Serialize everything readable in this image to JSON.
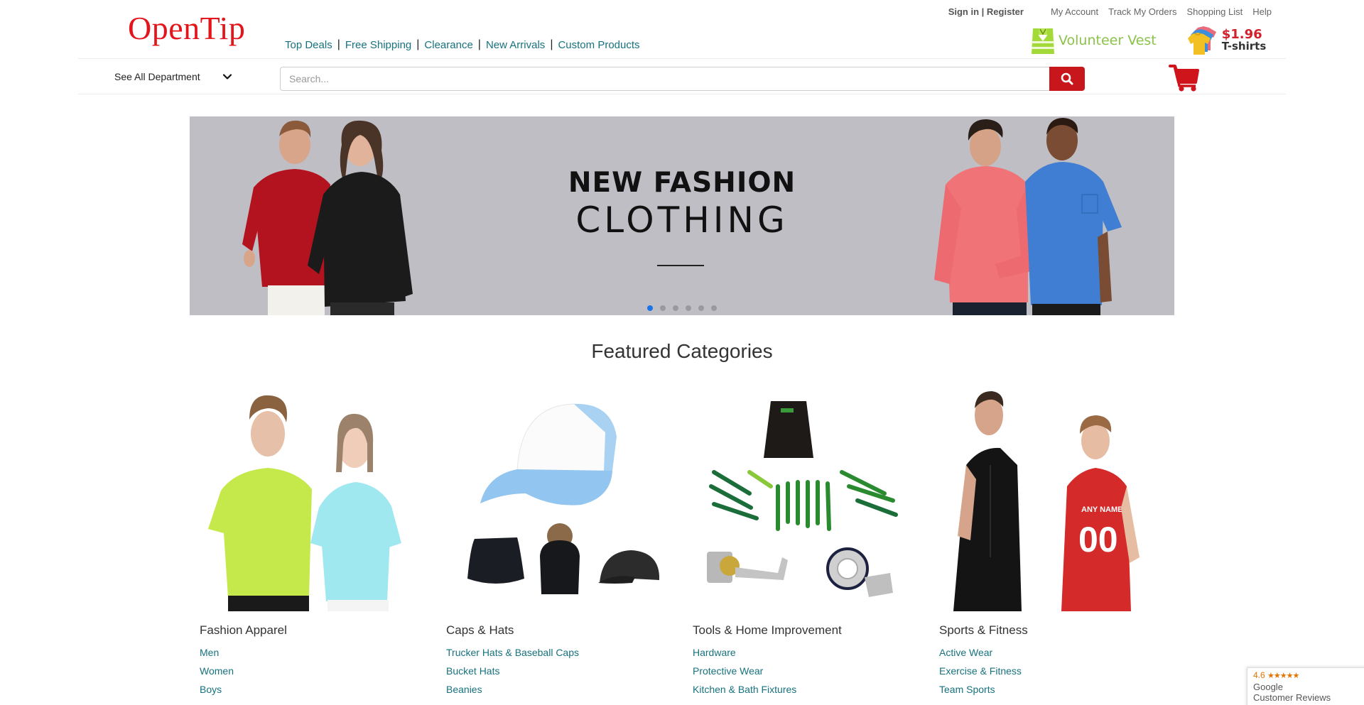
{
  "header": {
    "logo": "OpenTip",
    "promo_nav": [
      "Top Deals",
      "Free Shipping",
      "Clearance",
      "New Arrivals",
      "Custom Products"
    ],
    "nav_separator": "|",
    "sign_in": "Sign in",
    "register": "Register",
    "signin_separator": " | ",
    "top_links": [
      "My Account",
      "Track My Orders",
      "Shopping List",
      "Help"
    ],
    "vest_banner": "Volunteer Vest",
    "tshirt_price": "$1.96",
    "tshirt_label": "T-shirts",
    "department_label": "See All Department",
    "search_placeholder": "Search...",
    "search_value": ""
  },
  "hero": {
    "line1": "NEW FASHION",
    "line2": "CLOTHING",
    "slide_count": 6,
    "active_slide": 1
  },
  "featured": {
    "title": "Featured Categories",
    "categories": [
      {
        "name": "Fashion Apparel",
        "links": [
          "Men",
          "Women",
          "Boys"
        ]
      },
      {
        "name": "Caps & Hats",
        "links": [
          "Trucker Hats & Baseball Caps",
          "Bucket Hats",
          "Beanies"
        ]
      },
      {
        "name": "Tools & Home Improvement",
        "links": [
          "Hardware",
          "Protective Wear",
          "Kitchen & Bath Fixtures"
        ]
      },
      {
        "name": "Sports & Fitness",
        "links": [
          "Active Wear",
          "Exercise & Fitness",
          "Team Sports"
        ]
      }
    ]
  },
  "google_review": {
    "rating": "4.6",
    "stars": "★★★★★",
    "brand": "Google",
    "label": "Customer Reviews"
  },
  "colors": {
    "brand_red": "#e4141b",
    "button_red": "#c8161d",
    "link_teal": "#17727e",
    "active_dot": "#1a73e8",
    "review_orange": "#e37400"
  }
}
